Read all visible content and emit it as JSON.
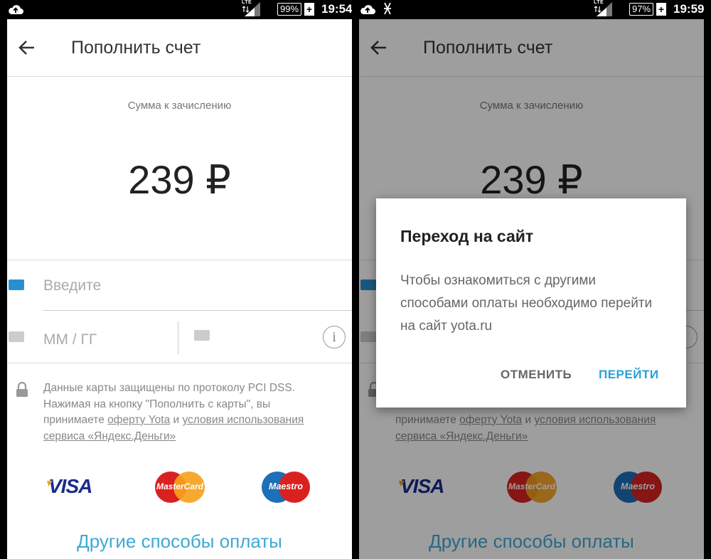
{
  "screens": [
    {
      "status": {
        "battery": "99%",
        "time": "19:54",
        "network": "LTE"
      },
      "toolbar": {
        "title": "Пополнить счет"
      },
      "amount_label": "Сумма к зачислению",
      "amount": "239 ₽",
      "card_field": {
        "placeholder": "Введите"
      },
      "expiry_field": {
        "placeholder": "ММ / ГГ"
      },
      "info_icon": "i",
      "security": {
        "line1": "Данные карты защищены по протоколу PCI DSS.",
        "line2a": "Нажимая на кнопку \"Пополнить с карты\", вы",
        "line3a": "принимаете ",
        "link_offer": "оферту Yota",
        "line3b": " и ",
        "link_terms1": "условия использования",
        "link_terms2": "сервиса «Яндекс.Деньги»"
      },
      "brands": {
        "visa": "VISA",
        "mastercard": "MasterCard",
        "maestro": "Maestro"
      },
      "other_methods": "Другие способы оплаты"
    },
    {
      "status": {
        "battery": "97%",
        "time": "19:59",
        "network": "LTE"
      },
      "toolbar": {
        "title": "Пополнить счет"
      },
      "amount_label": "Сумма к зачислению",
      "amount": "239 ₽",
      "security": {
        "line3a": "принимаете ",
        "link_offer": "оферту Yota",
        "line3b": " и ",
        "link_terms1": "условия использования",
        "link_terms2": "сервиса «Яндекс.Деньги»"
      },
      "brands": {
        "visa": "VISA",
        "mastercard": "MasterCard",
        "maestro": "Maestro"
      },
      "other_methods": "Другие способы оплаты",
      "dialog": {
        "title": "Переход на сайт",
        "message": "Чтобы ознакомиться с другими способами оплаты необходимо перейти на сайт yota.ru",
        "cancel": "ОТМЕНИТЬ",
        "confirm": "ПЕРЕЙТИ"
      }
    }
  ],
  "colors": {
    "accent": "#3fa9d3",
    "card_icon": "#2a8fd0",
    "card_icon_inactive": "#cccccc"
  }
}
